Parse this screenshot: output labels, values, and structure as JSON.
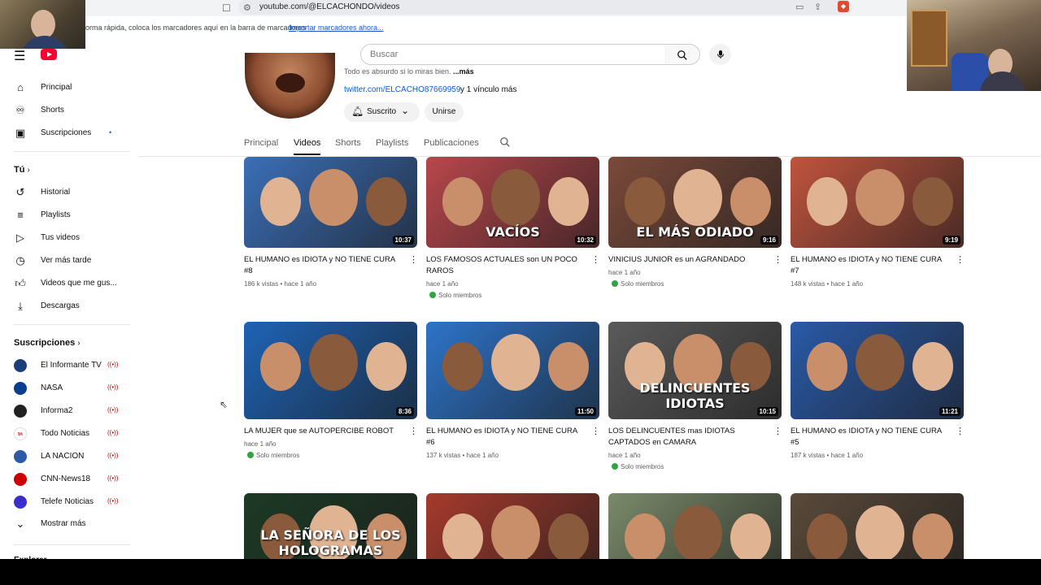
{
  "browser": {
    "url": "youtube.com/@ELCACHONDO/videos",
    "bookmarks_message": "orma rápida, coloca los marcadores aquí en la barra de marcadores",
    "bookmarks_import": "Importar marcadores ahora..."
  },
  "search": {
    "placeholder": "Buscar"
  },
  "sidebar": {
    "main": [
      {
        "label": "Principal",
        "icon": "home-icon"
      },
      {
        "label": "Shorts",
        "icon": "shorts-icon"
      },
      {
        "label": "Suscripciones",
        "icon": "subscriptions-icon"
      }
    ],
    "you_header": "Tú",
    "you": [
      {
        "label": "Historial",
        "icon": "history-icon"
      },
      {
        "label": "Playlists",
        "icon": "playlists-icon"
      },
      {
        "label": "Tus videos",
        "icon": "your-videos-icon"
      },
      {
        "label": "Ver más tarde",
        "icon": "watch-later-icon"
      },
      {
        "label": "Videos que me gus...",
        "icon": "like-icon"
      },
      {
        "label": "Descargas",
        "icon": "download-icon"
      }
    ],
    "subs_header": "Suscripciones",
    "subs": [
      {
        "label": "El Informante TV",
        "color": "#1c3d7a"
      },
      {
        "label": "NASA",
        "color": "#0b3d91"
      },
      {
        "label": "Informa2",
        "color": "#222222"
      },
      {
        "label": "Todo Noticias",
        "color": "#ffffff"
      },
      {
        "label": "LA NACION",
        "color": "#2f5aa8"
      },
      {
        "label": "CNN-News18",
        "color": "#cc0000"
      },
      {
        "label": "Telefe Noticias",
        "color": "#3a2fc9"
      }
    ],
    "show_more": "Mostrar más",
    "explore_partial": "Explorar"
  },
  "channel": {
    "desc": "Todo es absurdo si lo miras bien.",
    "desc_more": "...más",
    "link": "twitter.com/ELCACHO87669959",
    "link_more": "y 1 vínculo más",
    "subscribed": "Suscrito",
    "join": "Unirse"
  },
  "tabs": [
    "Principal",
    "Videos",
    "Shorts",
    "Playlists",
    "Publicaciones"
  ],
  "members_only": "Solo miembros",
  "videos": [
    {
      "title": "EL HUMANO es IDIOTA y NO TIENE CURA #8",
      "duration": "10:37",
      "meta": "186 k vistas • hace 1 año",
      "members": false,
      "overlay": "",
      "bg": "#3b6fb8"
    },
    {
      "title": "LOS FAMOSOS ACTUALES son UN POCO RAROS",
      "duration": "10:32",
      "meta": "hace 1 año",
      "members": true,
      "overlay": "VACÍOS",
      "bg": "#b8474c"
    },
    {
      "title": "VINICIUS JUNIOR es un AGRANDADO",
      "duration": "9:16",
      "meta": "hace 1 año",
      "members": true,
      "overlay": "EL MÁS ODIADO",
      "bg": "#7a4a3a"
    },
    {
      "title": "EL HUMANO es IDIOTA y NO TIENE CURA #7",
      "duration": "9:19",
      "meta": "148 k vistas • hace 1 año",
      "members": false,
      "overlay": "",
      "bg": "#c0543e"
    },
    {
      "title": "LA MUJER que se AUTOPERCIBE ROBOT",
      "duration": "8:36",
      "meta": "hace 1 año",
      "members": true,
      "overlay": "",
      "bg": "#1e63b5"
    },
    {
      "title": "EL HUMANO es IDIOTA y NO TIENE CURA #6",
      "duration": "11:50",
      "meta": "137 k vistas • hace 1 año",
      "members": false,
      "overlay": "",
      "bg": "#2d74c9"
    },
    {
      "title": "LOS DELINCUENTES mas IDIOTAS CAPTADOS en CAMARA",
      "duration": "10:15",
      "meta": "hace 1 año",
      "members": true,
      "overlay": "DELINCUENTES IDIOTAS",
      "bg": "#5a5a5a"
    },
    {
      "title": "EL HUMANO es IDIOTA y NO TIENE CURA #5",
      "duration": "11:21",
      "meta": "187 k vistas • hace 1 año",
      "members": false,
      "overlay": "",
      "bg": "#2a5aa8"
    },
    {
      "title": "",
      "duration": "",
      "meta": "",
      "members": false,
      "overlay": "LA SEÑORA DE LOS HOLOGRAMAS",
      "bg": "#1d3a25"
    },
    {
      "title": "",
      "duration": "",
      "meta": "",
      "members": false,
      "overlay": "",
      "bg": "#a63a2d"
    },
    {
      "title": "",
      "duration": "",
      "meta": "",
      "members": false,
      "overlay": "",
      "bg": "#7a8a6a"
    },
    {
      "title": "",
      "duration": "",
      "meta": "",
      "members": false,
      "overlay": "",
      "bg": "#5a4a3a"
    }
  ]
}
